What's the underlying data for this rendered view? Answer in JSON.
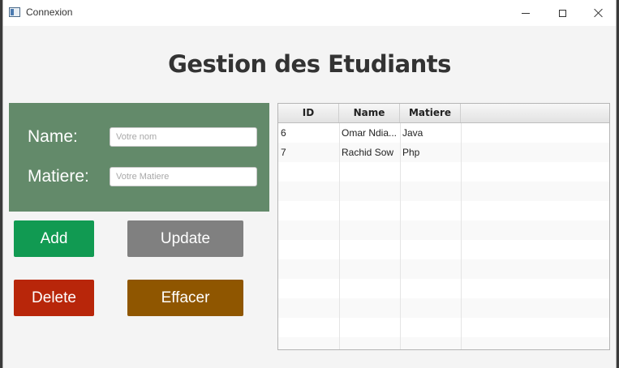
{
  "window": {
    "title": "Connexion"
  },
  "page": {
    "heading": "Gestion des Etudiants"
  },
  "form": {
    "name_label": "Name:",
    "name_placeholder": "Votre nom",
    "matiere_label": "Matiere:",
    "matiere_placeholder": "Votre Matiere",
    "panel_color": "#638a6a"
  },
  "buttons": {
    "add": {
      "label": "Add",
      "color": "#119a52"
    },
    "update": {
      "label": "Update",
      "color": "#808080"
    },
    "delete": {
      "label": "Delete",
      "color": "#b8260a"
    },
    "effacer": {
      "label": "Effacer",
      "color": "#8f5600"
    }
  },
  "table": {
    "columns": [
      "ID",
      "Name",
      "Matiere"
    ],
    "rows": [
      [
        "6",
        "Omar Ndia...",
        "Java"
      ],
      [
        "7",
        "Rachid Sow",
        "Php"
      ]
    ]
  }
}
